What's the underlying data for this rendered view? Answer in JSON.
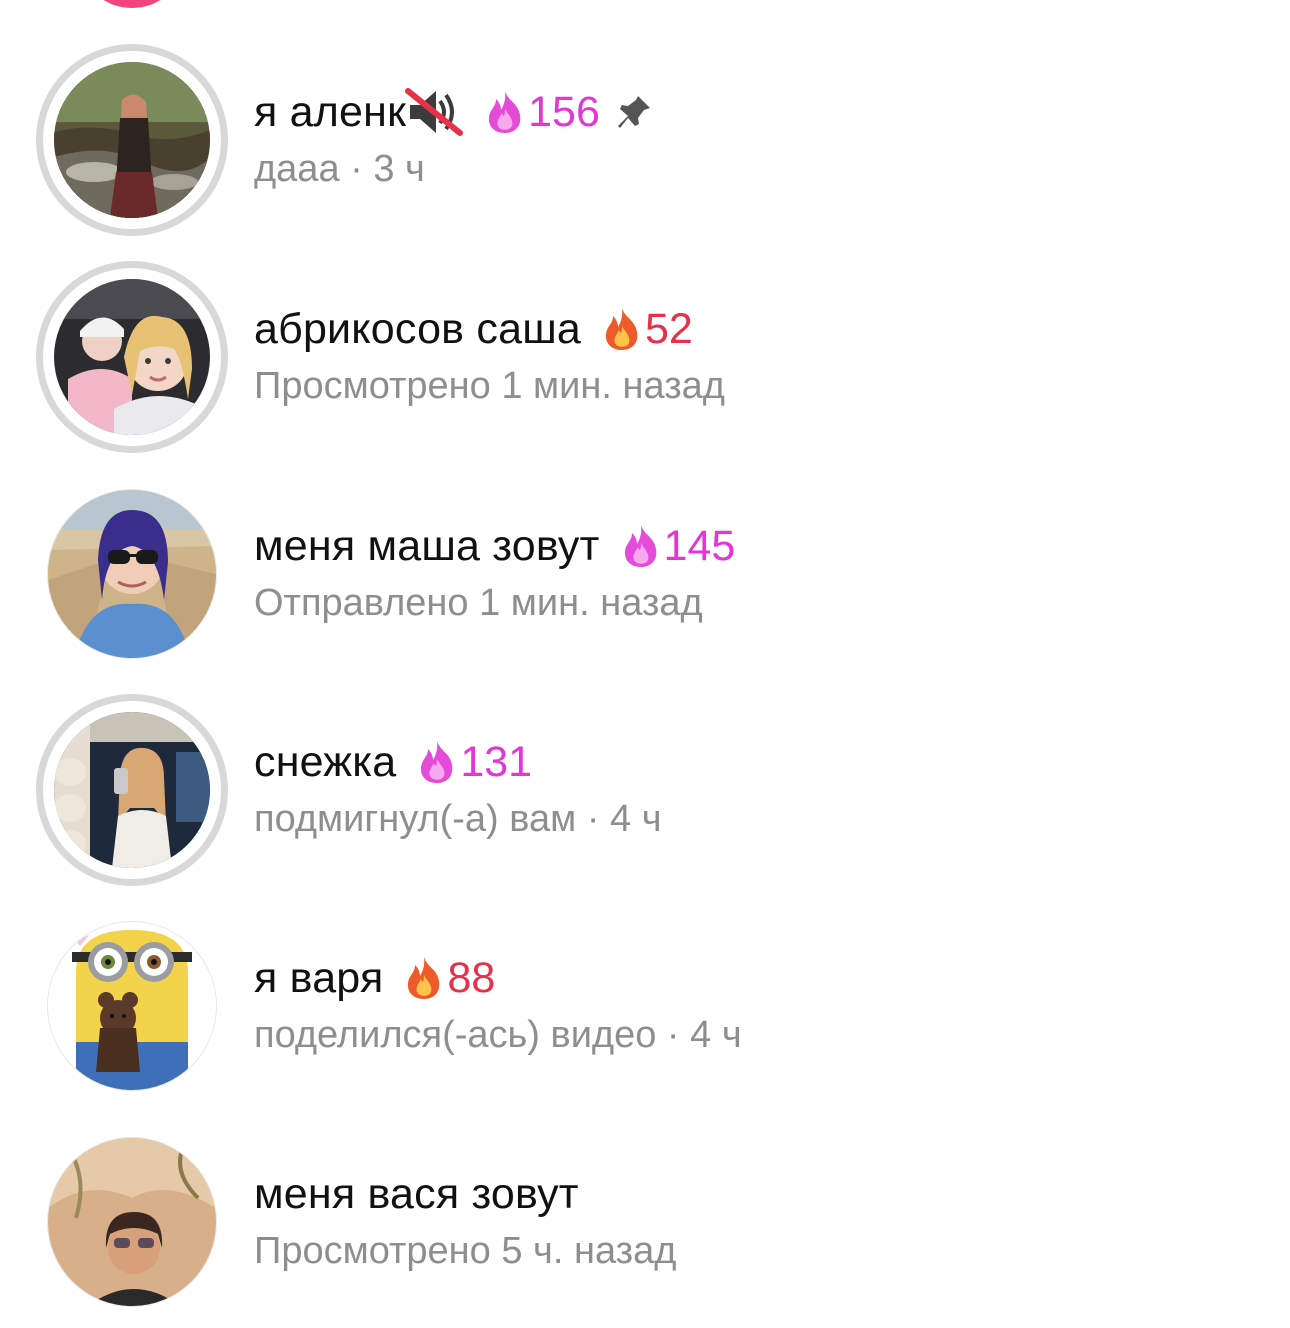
{
  "colors": {
    "text_primary": "#111111",
    "text_secondary": "#8e8e8e",
    "streak_pink": "#e535d6",
    "streak_red": "#e8304a",
    "story_ring": "#d8d8d8",
    "top_story": "#f2457e"
  },
  "chats": [
    {
      "name": "я аленк",
      "streak_icon": "pink-fire-icon",
      "streak_count": "156",
      "streak_color": "#e535d6",
      "muted": true,
      "pinned": true,
      "subtitle": "дааа · 3 ч",
      "has_story_ring": true,
      "avatar": "avatar-photo-forest"
    },
    {
      "name": "абрикосов саша",
      "streak_icon": "fire-icon",
      "streak_count": "52",
      "streak_color": "#e8304a",
      "subtitle": "Просмотрено 1 мин. назад",
      "has_story_ring": true,
      "avatar": "avatar-photo-selfie"
    },
    {
      "name": "меня маша зовут",
      "streak_icon": "pink-fire-icon",
      "streak_count": "145",
      "streak_color": "#e535d6",
      "subtitle": "Отправлено 1 мин. назад",
      "has_story_ring": false,
      "avatar": "avatar-photo-sunglasses"
    },
    {
      "name": "снежка",
      "streak_icon": "pink-fire-icon",
      "streak_count": "131",
      "streak_color": "#e535d6",
      "subtitle": "подмигнул(-а) вам · 4 ч",
      "has_story_ring": true,
      "avatar": "avatar-photo-mirror"
    },
    {
      "name": "я варя",
      "streak_icon": "fire-icon",
      "streak_count": "88",
      "streak_color": "#e8304a",
      "subtitle": "поделился(-ась) видео · 4 ч",
      "has_story_ring": false,
      "avatar": "avatar-minion"
    },
    {
      "name": "меня вася зовут",
      "subtitle": "Просмотрено 5 ч. назад",
      "has_story_ring": false,
      "avatar": "avatar-photo-portrait"
    }
  ]
}
